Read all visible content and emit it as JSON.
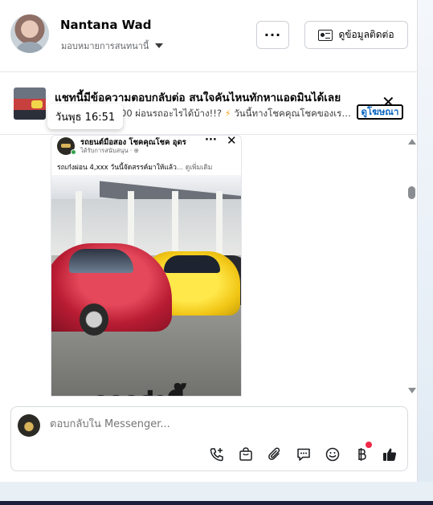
{
  "header": {
    "name": "Nantana Wad",
    "subtitle": "มอบหมายการสนทนานี้",
    "more_label": "···",
    "contact_label": "ดูข้อมูลติดต่อ"
  },
  "ad": {
    "title": "แชทนี้มีข้อความตอบกลับต่อ สนใจคันไหนทักหาแอดมินได้เลย",
    "subtitle_prefix": "00 ผ่อนรถอะไรได้บ้าง!!?",
    "subtitle_suffix": "วันนี้ทางโชคคุณโชคของเรา...",
    "bolt": "⚡",
    "timestamp": "วันพุธ 16:51",
    "view_ad_label": "ดูโฆษณา",
    "close_label": "✕"
  },
  "post": {
    "page_name": "รถยนต์มือสอง โชคคุณโชค อุดร",
    "meta": "ได้รับการสนับสนุน · ⊕",
    "more_label": "···",
    "close_label": "✕",
    "text": "รถเก๋งผ่อน 4,xxx วันนี้จัดสรรค์มาให้แล้ว",
    "see_more": "... ดูเพิ่มเติม",
    "overlay_text": "ถูกกว่านี้"
  },
  "composer": {
    "placeholder": "ตอบกลับใน Messenger..."
  },
  "icons": {
    "header_contact": "id-card-icon",
    "composer_tools": [
      "phone-add-icon",
      "shopping-bag-icon",
      "paperclip-icon",
      "saved-replies-icon",
      "emoji-icon",
      "baht-icon",
      "like-icon"
    ]
  },
  "colors": {
    "accent": "#0a66c2",
    "text": "#050505",
    "muted": "#65676b",
    "notification": "#f02849"
  }
}
